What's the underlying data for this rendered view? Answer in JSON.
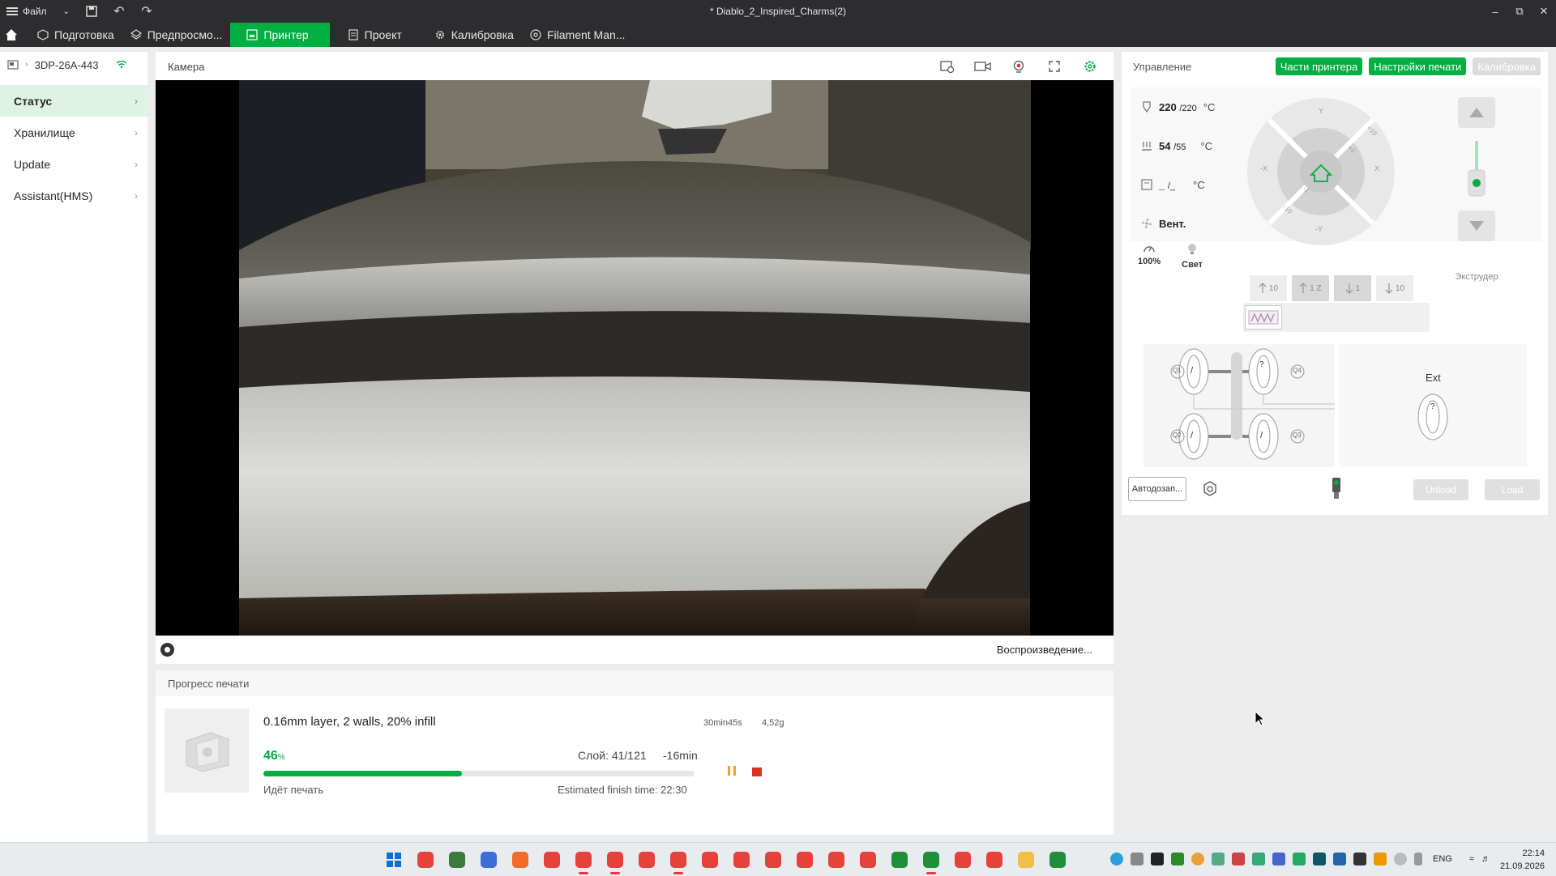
{
  "titlebar": {
    "menu_label": "Файл",
    "title": "* Diablo_2_Inspired_Charms(2)"
  },
  "tabs": [
    {
      "label": "Подготовка"
    },
    {
      "label": "Предпросмо..."
    },
    {
      "label": "Принтер"
    },
    {
      "label": "Проект"
    },
    {
      "label": "Калибровка"
    },
    {
      "label": "Filament Man..."
    }
  ],
  "sidebar": {
    "device": "3DP-26A-443",
    "items": [
      {
        "label": "Статус"
      },
      {
        "label": "Хранилище"
      },
      {
        "label": "Update"
      },
      {
        "label": "Assistant(HMS)"
      }
    ]
  },
  "camera": {
    "title": "Камера",
    "playback_status": "Воспроизведение..."
  },
  "progress": {
    "title": "Прогресс печати",
    "job_name": "0.16mm layer, 2 walls, 20% infill",
    "time": "30min45s",
    "weight": "4,52g",
    "percent": 46,
    "percent_text": "46",
    "percent_unit": "%",
    "layer": "Слой: 41/121",
    "remaining": "-16min",
    "status": "Идёт печать",
    "finish_time": "Estimated finish time: 22:30"
  },
  "control": {
    "title": "Управление",
    "btn_parts": "Части принтера",
    "btn_print_settings": "Настройки печати",
    "btn_calibration": "Калибровка",
    "nozzle_temp": "220",
    "nozzle_target": "/220",
    "bed_temp": "54",
    "bed_target": "/55",
    "chamber_temp": "_",
    "chamber_target": "/_",
    "temp_unit": "°C",
    "fan_label": "Вент.",
    "speed": "100%",
    "light": "Свет",
    "axis_y": "Y",
    "axis_neg_y": "-Y",
    "axis_x": "X",
    "axis_neg_x": "-X",
    "axis_p10": "+10",
    "axis_p1": "+1",
    "axis_m1": "-1",
    "axis_m10": "-10",
    "z_up_10": "10",
    "z_up_1": "1",
    "z_label": "Z",
    "z_down_1": "1",
    "z_down_10": "10",
    "extruder_label": "Экструдер",
    "ext_title": "Ext",
    "ams_slots": [
      "Q1",
      "Q2",
      "Q3",
      "Q4"
    ],
    "autoload": "Автодозап...",
    "unload": "Unload",
    "load": "Load",
    "unknown_mark": "?",
    "slash_mark": "/"
  },
  "taskbar": {
    "lang": "ENG",
    "time": "22:14",
    "date": "21.09.2026"
  },
  "colors": {
    "accent": "#00ae42",
    "titlebar": "#2d2d2f",
    "stop": "#e03020",
    "pause": "#f0a030"
  }
}
